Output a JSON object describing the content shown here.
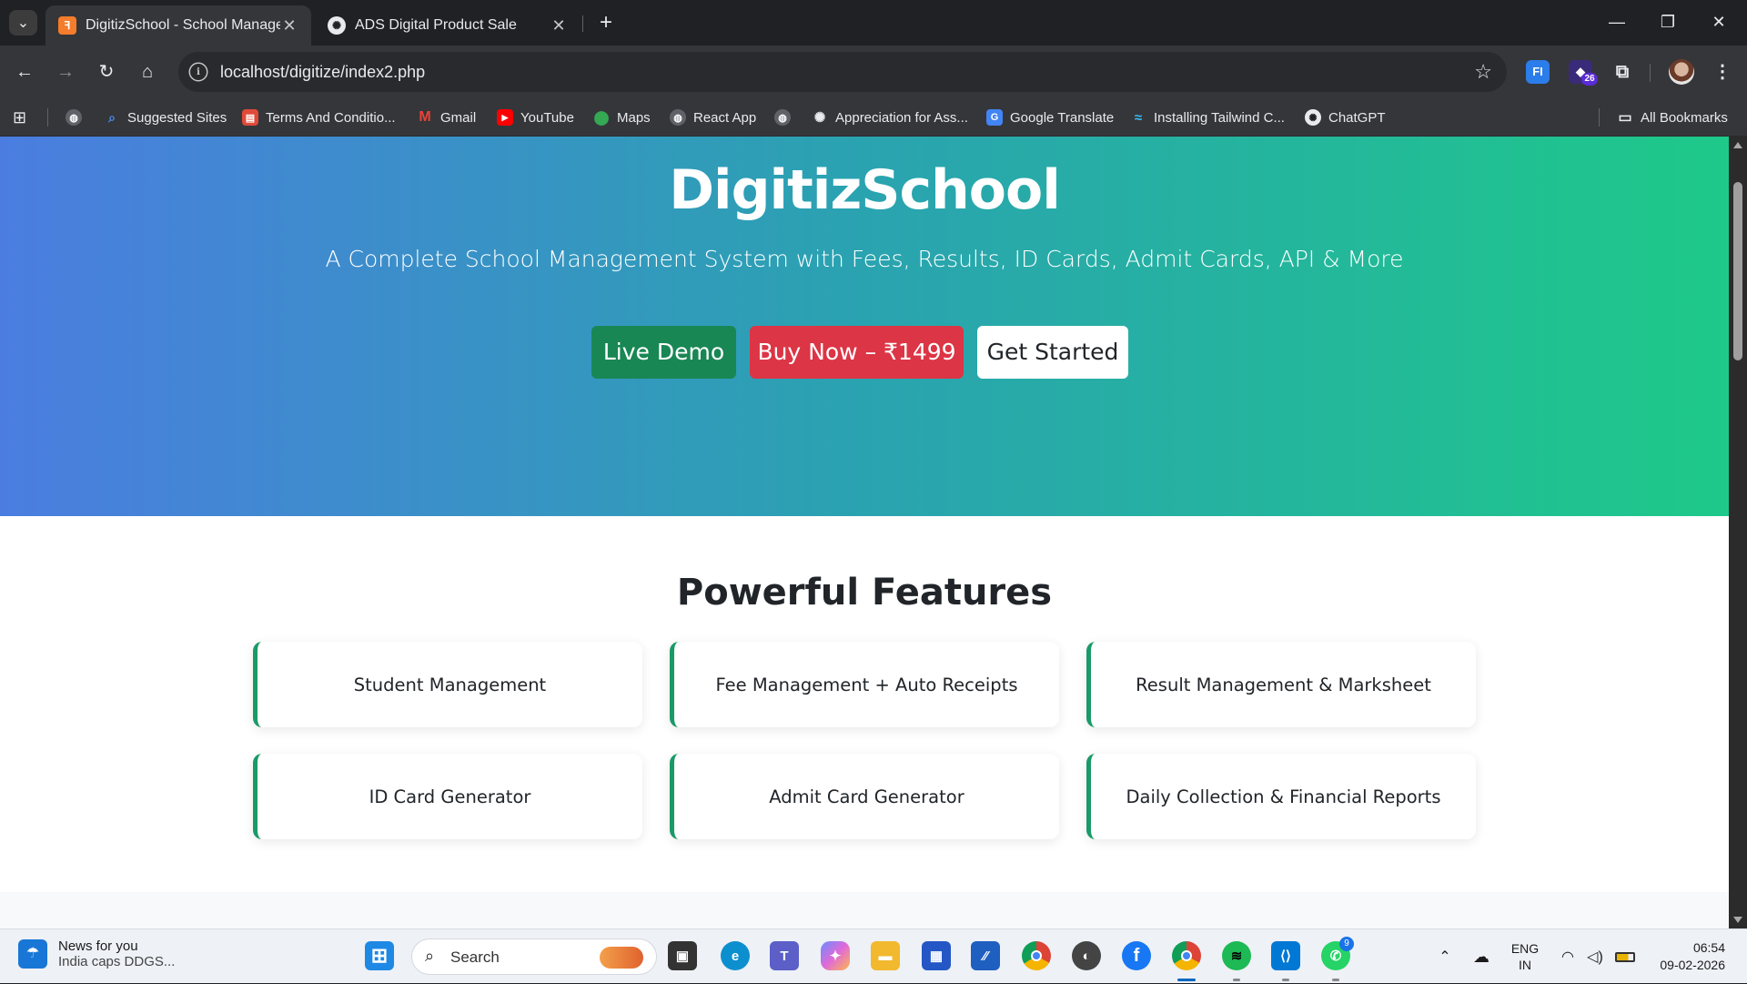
{
  "browser": {
    "tabs": [
      {
        "title": "DigitizSchool - School Management",
        "active": true,
        "favicon": "xampp-icon"
      },
      {
        "title": "ADS Digital Product Sale",
        "active": false,
        "favicon": "openai-icon"
      }
    ],
    "new_tab": "+",
    "window_controls": {
      "minimize": "—",
      "restore": "❐",
      "close": "✕"
    },
    "url": "localhost/digitize/index2.php",
    "extensions": [
      {
        "name": "fi-extension-icon",
        "label": "FI",
        "color": "#2b7de9"
      },
      {
        "name": "ai-extension-icon",
        "label": "26",
        "color": "#5b2bd6"
      }
    ],
    "bookmarks": [
      {
        "label": "",
        "icon": "globe-icon",
        "color": "#8a8a8a"
      },
      {
        "label": "Suggested Sites",
        "icon": "search-icon",
        "color": "#1a73e8"
      },
      {
        "label": "Terms And Conditio...",
        "icon": "page-icon",
        "color": "#e04a3a"
      },
      {
        "label": "Gmail",
        "icon": "gmail-icon",
        "color": "#ea4335"
      },
      {
        "label": "YouTube",
        "icon": "youtube-icon",
        "color": "#ff0000"
      },
      {
        "label": "Maps",
        "icon": "maps-icon",
        "color": "#34a853"
      },
      {
        "label": "React App",
        "icon": "globe-icon",
        "color": "#8a8a8a"
      },
      {
        "label": "",
        "icon": "globe-icon",
        "color": "#8a8a8a"
      },
      {
        "label": "Appreciation for Ass...",
        "icon": "openai-icon",
        "color": "#777"
      },
      {
        "label": "Google Translate",
        "icon": "translate-icon",
        "color": "#4285f4"
      },
      {
        "label": "Installing Tailwind C...",
        "icon": "tailwind-icon",
        "color": "#38bdf8"
      },
      {
        "label": "ChatGPT",
        "icon": "openai-icon",
        "color": "#777"
      }
    ],
    "all_bookmarks": "All Bookmarks"
  },
  "hero": {
    "title": "DigitizSchool",
    "subtitle": "A Complete School Management System with Fees, Results, ID Cards, Admit Cards, API & More",
    "buttons": {
      "demo": "Live Demo",
      "buy": "Buy Now – ₹1499",
      "start": "Get Started"
    }
  },
  "features": {
    "title": "Powerful Features",
    "items": [
      "Student Management",
      "Fee Management + Auto Receipts",
      "Result Management & Marksheet",
      "ID Card Generator",
      "Admit Card Generator",
      "Daily Collection & Financial Reports"
    ]
  },
  "colors": {
    "hero_start": "#4b7de0",
    "hero_end": "#1ec989",
    "demo_button": "#198754",
    "buy_button": "#dc3545",
    "card_accent": "#1a9a68"
  },
  "taskbar": {
    "news_title": "News for you",
    "news_sub": "India caps DDGS...",
    "search_placeholder": "Search",
    "apps": [
      {
        "name": "start-icon",
        "label": "⊞",
        "color": "#1e88e5"
      },
      {
        "name": "task-view-icon",
        "label": "▣",
        "color": "#333"
      },
      {
        "name": "edge-icon",
        "label": "e",
        "color": "#0c8fcf"
      },
      {
        "name": "teams-icon",
        "label": "T",
        "color": "#5b5fc7"
      },
      {
        "name": "copilot-icon",
        "label": "✦",
        "color": "#d66ad8"
      },
      {
        "name": "file-explorer-icon",
        "label": "▬",
        "color": "#f2b92e"
      },
      {
        "name": "store-icon",
        "label": "▦",
        "color": "#2457c5"
      },
      {
        "name": "vscode-insiders-icon",
        "label": "⁄⁄",
        "color": "#1f5fbf"
      },
      {
        "name": "chrome-icon",
        "label": "◉",
        "color": "#db4437"
      },
      {
        "name": "media-icon",
        "label": "◐",
        "color": "#444"
      },
      {
        "name": "facebook-icon",
        "label": "f",
        "color": "#1877f2"
      },
      {
        "name": "chrome-profile-icon",
        "label": "◉",
        "color": "#db4437"
      },
      {
        "name": "spotify-icon",
        "label": "≋",
        "color": "#1db954"
      },
      {
        "name": "vscode-icon",
        "label": "⟨⟩",
        "color": "#0078d4"
      },
      {
        "name": "whatsapp-icon",
        "label": "✆",
        "color": "#25d366"
      }
    ],
    "whatsapp_badge": "9",
    "language": "ENG",
    "region": "IN",
    "time": "06:54",
    "date": "09-02-2026"
  }
}
